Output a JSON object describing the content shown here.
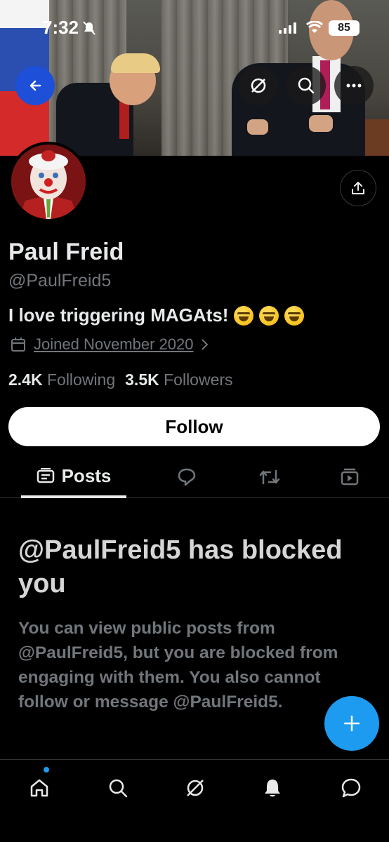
{
  "status_bar": {
    "time": "7:32",
    "battery": "85"
  },
  "profile": {
    "name": "Paul Freid",
    "handle": "@PaulFreid5",
    "bio": "I love triggering MAGAts!",
    "bio_emojis": [
      "grinning-squinting-face",
      "grinning-squinting-face",
      "grinning-squinting-face"
    ],
    "joined": "Joined November 2020",
    "following_count": "2.4K",
    "following_label": "Following",
    "followers_count": "3.5K",
    "followers_label": "Followers",
    "follow_button": "Follow"
  },
  "tabs": [
    {
      "label": "Posts",
      "icon": "posts-icon",
      "active": true
    },
    {
      "label": "",
      "icon": "replies-icon"
    },
    {
      "label": "",
      "icon": "reposts-icon"
    },
    {
      "label": "",
      "icon": "media-icon"
    }
  ],
  "blocked": {
    "title": "@PaulFreid5 has blocked you",
    "message": "You can view public posts from @PaulFreid5, but you are blocked from engaging with them. You also cannot follow or message @PaulFreid5."
  },
  "bottom_nav": [
    "home-icon",
    "search-icon",
    "grok-icon",
    "notifications-icon",
    "messages-icon"
  ],
  "colors": {
    "accent": "#1d9bf0",
    "background": "#000000",
    "muted": "#71767b",
    "text": "#e7e9ea"
  }
}
